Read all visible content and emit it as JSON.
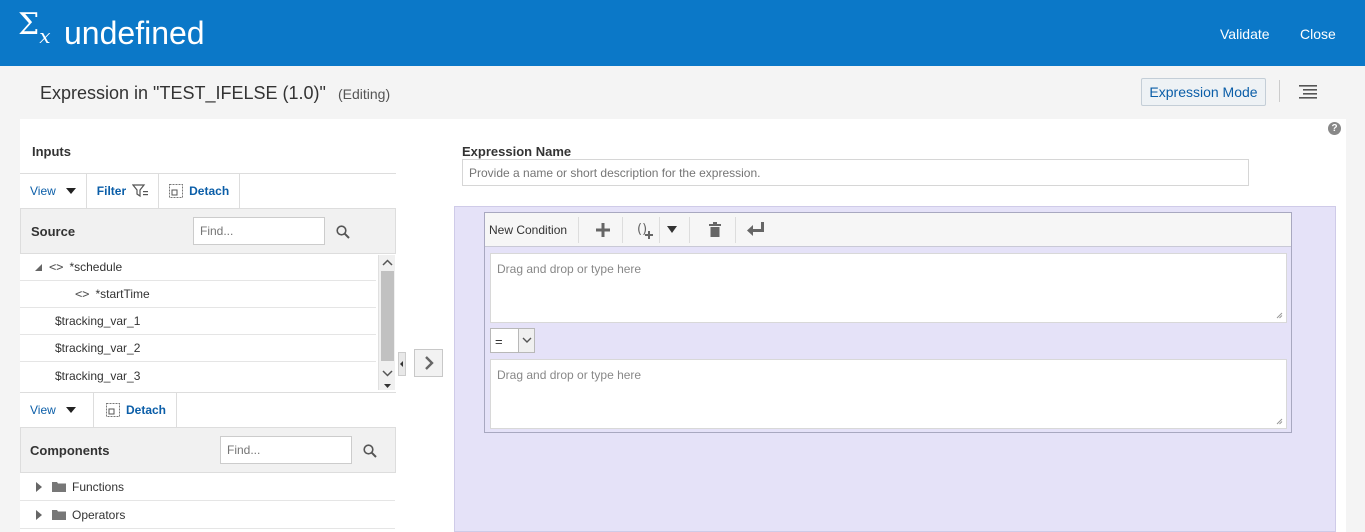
{
  "header": {
    "icon_symbol": "Σ",
    "icon_sub": "x",
    "title": "undefined",
    "validate_label": "Validate",
    "close_label": "Close",
    "background": "#0b78c8"
  },
  "subheader": {
    "title": "Expression in \"TEST_IFELSE (1.0)\"",
    "status": "(Editing)",
    "mode_button": "Expression Mode"
  },
  "inputs": {
    "title": "Inputs",
    "toolbar": {
      "view_label": "View",
      "filter_label": "Filter",
      "detach_label": "Detach"
    },
    "source": {
      "label": "Source",
      "find_placeholder": "Find...",
      "items": [
        {
          "label": "*schedule"
        },
        {
          "label": "*startTime"
        },
        {
          "label": "$tracking_var_1"
        },
        {
          "label": "$tracking_var_2"
        },
        {
          "label": "$tracking_var_3"
        }
      ]
    },
    "components_toolbar": {
      "view_label": "View",
      "detach_label": "Detach"
    },
    "components": {
      "label": "Components",
      "find_placeholder": "Find...",
      "items": [
        {
          "label": "Functions"
        },
        {
          "label": "Operators"
        }
      ]
    }
  },
  "expression": {
    "name_label": "Expression Name",
    "name_placeholder": "Provide a name or short description for the expression.",
    "condition": {
      "new_condition_label": "New Condition",
      "left_placeholder": "Drag and drop or type here",
      "operator": "=",
      "right_placeholder": "Drag and drop or type here"
    },
    "area_color": "#e5e2f8"
  },
  "help_symbol": "?"
}
